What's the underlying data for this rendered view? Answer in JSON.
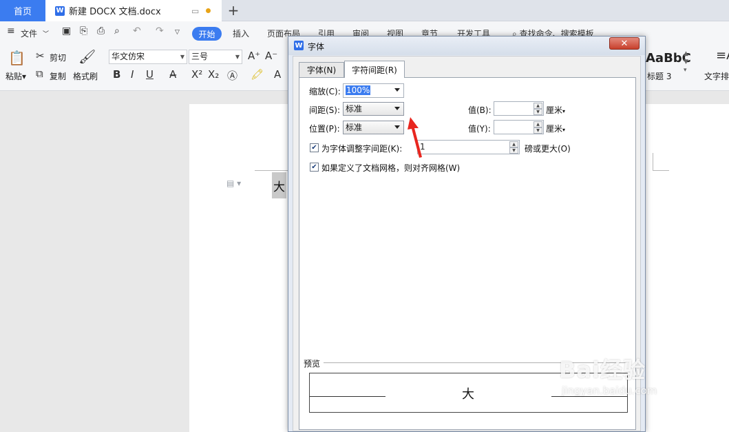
{
  "tabs": {
    "home": "首页",
    "doc": "新建 DOCX 文档.docx",
    "new": "+"
  },
  "menu": {
    "file": "文件",
    "start": "开始",
    "insert": "插入",
    "layout": "页面布局",
    "ref": "引用",
    "review": "审阅",
    "view": "视图",
    "section": "章节",
    "dev": "开发工具",
    "find": "查找命令、搜索模板"
  },
  "ribbon": {
    "paste": "粘贴",
    "cut": "剪切",
    "copy": "复制",
    "format_painter": "格式刷",
    "font_name": "华文仿宋",
    "font_size": "三号",
    "style_preview": "AaBbC",
    "style_name": "标题 3",
    "text_layout": "文字排"
  },
  "document": {
    "selected_char": "大"
  },
  "dialog": {
    "title": "字体",
    "tab_font": "字体(N)",
    "tab_spacing": "字符间距(R)",
    "scale_label": "缩放(C):",
    "scale_value": "100%",
    "spacing_label": "间距(S):",
    "spacing_value": "标准",
    "position_label": "位置(P):",
    "position_value": "标准",
    "value_b_label": "值(B):",
    "value_y_label": "值(Y):",
    "unit_b": "厘米",
    "unit_y": "厘米",
    "kerning_label": "为字体调整字间距(K):",
    "kerning_value": "1",
    "kerning_suffix": "磅或更大(O)",
    "grid_label": "如果定义了文档网格，则对齐网格(W)",
    "preview_label": "预览",
    "preview_char": "大"
  },
  "watermark": {
    "brand": "Bai经验",
    "url": "jingyan.baidu.com"
  },
  "colors": {
    "accent": "#3b7cf0",
    "arrow": "#e8261f",
    "close": "#c7402c"
  }
}
